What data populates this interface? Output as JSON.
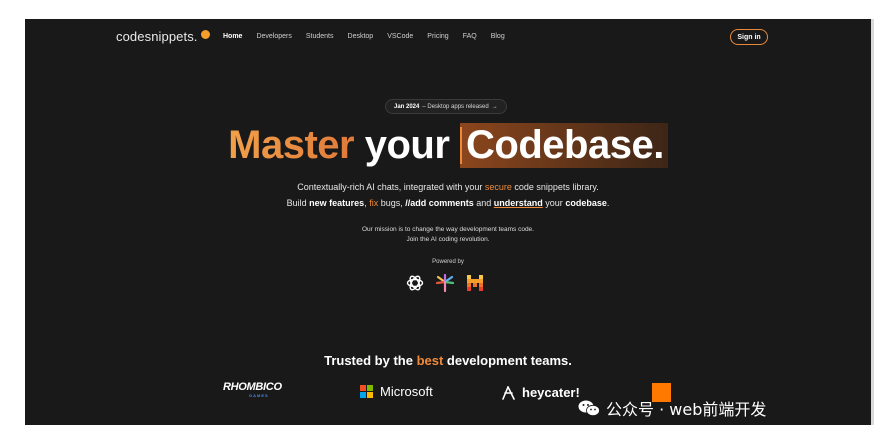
{
  "nav": {
    "logo_text": "codesnippets.",
    "links": [
      "Home",
      "Developers",
      "Students",
      "Desktop",
      "VSCode",
      "Pricing",
      "FAQ",
      "Blog"
    ],
    "active_link": "Home",
    "signin_label": "Sign in"
  },
  "announcement": {
    "date": "Jan 2024",
    "text": "– Desktop apps released",
    "arrow": "→"
  },
  "hero": {
    "headline_master": "Master",
    "headline_your": "your",
    "headline_code": "Codebase.",
    "sub1_a": "Contextually-rich AI chats, integrated with your ",
    "sub1_secure": "secure",
    "sub1_b": " code snippets library.",
    "sub2_a": "Build ",
    "sub2_new": "new features",
    "sub2_b": ", ",
    "sub2_fix": "fix",
    "sub2_c": " bugs, ",
    "sub2_comment": "//add comments",
    "sub2_d": " and ",
    "sub2_understand": "understand",
    "sub2_e": " your ",
    "sub2_codebase": "codebase",
    "sub2_f": ".",
    "mission_line1": "Our mission is to change the way development teams code.",
    "mission_line2": "Join the AI coding revolution.",
    "powered_by": "Powered by"
  },
  "powered_icons": [
    "openai-icon",
    "palm-icon",
    "mistral-icon"
  ],
  "trusted": {
    "a": "Trusted by the ",
    "best": "best",
    "b": " development teams."
  },
  "clients": {
    "rhombico": "RHOMBICO",
    "rhombico_sub": "GAMES",
    "microsoft": "Microsoft",
    "heycater": "heycater!"
  },
  "watermark": {
    "text": "公众号 · web前端开发"
  },
  "colors": {
    "background": "#191919",
    "accent": "#f08a3a",
    "orange_brand": "#ff7900"
  }
}
